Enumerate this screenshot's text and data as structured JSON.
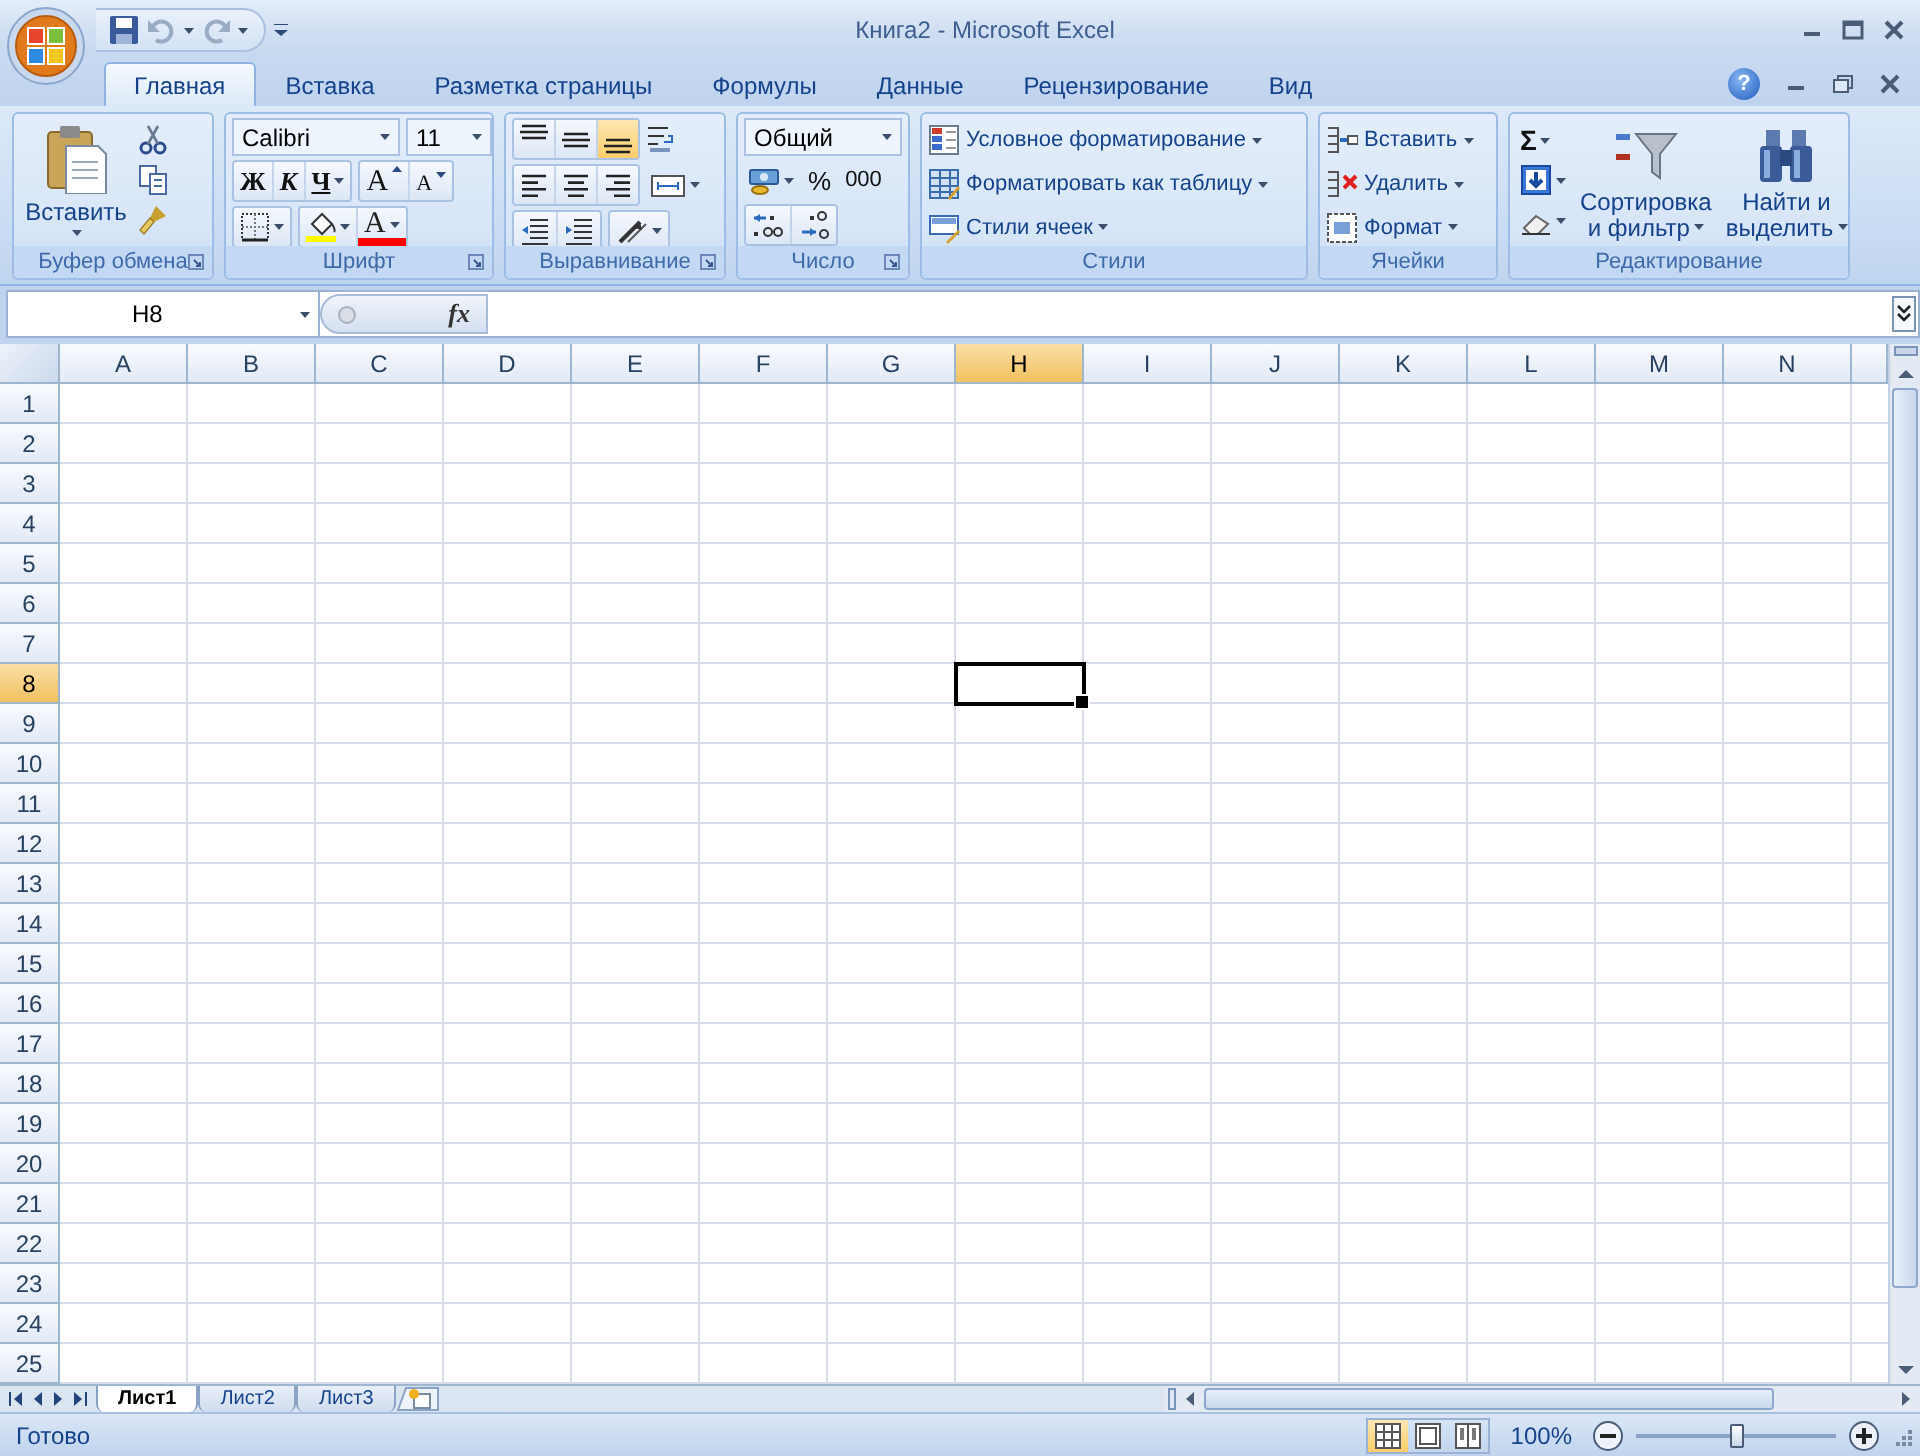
{
  "window": {
    "title": "Книга2 - Microsoft Excel"
  },
  "tabs": [
    {
      "label": "Главная",
      "selected": true
    },
    {
      "label": "Вставка",
      "selected": false
    },
    {
      "label": "Разметка страницы",
      "selected": false
    },
    {
      "label": "Формулы",
      "selected": false
    },
    {
      "label": "Данные",
      "selected": false
    },
    {
      "label": "Рецензирование",
      "selected": false
    },
    {
      "label": "Вид",
      "selected": false
    }
  ],
  "help": "?",
  "ribbon": {
    "groups": [
      {
        "kind": "clipboard",
        "label": "Буфер обмена",
        "paste": "Вставить"
      },
      {
        "kind": "font",
        "label": "Шрифт",
        "font_name": "Calibri",
        "font_size": "11",
        "bold": "Ж",
        "italic": "К",
        "underline": "Ч",
        "grow": "A",
        "shrink": "A",
        "font_color": "A"
      },
      {
        "kind": "alignment",
        "label": "Выравнивание",
        "vertical_align": [
          {
            "kind": "top",
            "selected": false
          },
          {
            "kind": "middle",
            "selected": false
          },
          {
            "kind": "bottom",
            "selected": true
          }
        ],
        "horizontal_align": [
          {
            "kind": "left",
            "selected": false
          },
          {
            "kind": "center",
            "selected": false
          },
          {
            "kind": "right",
            "selected": false
          }
        ]
      },
      {
        "kind": "number",
        "label": "Число",
        "format": "Общий",
        "percent": "%",
        "thousands": "000"
      },
      {
        "kind": "styles",
        "label": "Стили",
        "commands": [
          "Условное форматирование",
          "Форматировать как таблицу",
          "Стили ячеек"
        ]
      },
      {
        "kind": "cells",
        "label": "Ячейки",
        "commands": [
          "Вставить",
          "Удалить",
          "Формат"
        ]
      },
      {
        "kind": "editing",
        "label": "Редактирование",
        "sum": "Σ",
        "sort": [
          "Сортировка",
          "и фильтр"
        ],
        "find": [
          "Найти и",
          "выделить"
        ]
      }
    ]
  },
  "formula_bar": {
    "name_box": "H8",
    "function_label": "fx"
  },
  "grid": {
    "columns": [
      {
        "label": "A",
        "selected": false
      },
      {
        "label": "B",
        "selected": false
      },
      {
        "label": "C",
        "selected": false
      },
      {
        "label": "D",
        "selected": false
      },
      {
        "label": "E",
        "selected": false
      },
      {
        "label": "F",
        "selected": false
      },
      {
        "label": "G",
        "selected": false
      },
      {
        "label": "H",
        "selected": true
      },
      {
        "label": "I",
        "selected": false
      },
      {
        "label": "J",
        "selected": false
      },
      {
        "label": "K",
        "selected": false
      },
      {
        "label": "L",
        "selected": false
      },
      {
        "label": "M",
        "selected": false
      },
      {
        "label": "N",
        "selected": false
      }
    ],
    "rows": [
      {
        "label": "1",
        "selected": false
      },
      {
        "label": "2",
        "selected": false
      },
      {
        "label": "3",
        "selected": false
      },
      {
        "label": "4",
        "selected": false
      },
      {
        "label": "5",
        "selected": false
      },
      {
        "label": "6",
        "selected": false
      },
      {
        "label": "7",
        "selected": false
      },
      {
        "label": "8",
        "selected": true
      },
      {
        "label": "9",
        "selected": false
      },
      {
        "label": "10",
        "selected": false
      },
      {
        "label": "11",
        "selected": false
      },
      {
        "label": "12",
        "selected": false
      },
      {
        "label": "13",
        "selected": false
      },
      {
        "label": "14",
        "selected": false
      },
      {
        "label": "15",
        "selected": false
      },
      {
        "label": "16",
        "selected": false
      },
      {
        "label": "17",
        "selected": false
      },
      {
        "label": "18",
        "selected": false
      },
      {
        "label": "19",
        "selected": false
      },
      {
        "label": "20",
        "selected": false
      },
      {
        "label": "21",
        "selected": false
      },
      {
        "label": "22",
        "selected": false
      },
      {
        "label": "23",
        "selected": false
      },
      {
        "label": "24",
        "selected": false
      },
      {
        "label": "25",
        "selected": false
      }
    ]
  },
  "sheets": [
    {
      "label": "Лист1",
      "selected": true
    },
    {
      "label": "Лист2",
      "selected": false
    },
    {
      "label": "Лист3",
      "selected": false
    }
  ],
  "status_bar": {
    "text": "Готово",
    "views": [
      {
        "kind": "normal",
        "selected": true
      },
      {
        "kind": "page_layout",
        "selected": false
      },
      {
        "kind": "page_break",
        "selected": false
      }
    ],
    "zoom": "100%",
    "zoom_slider": {
      "level": 0.5
    }
  }
}
